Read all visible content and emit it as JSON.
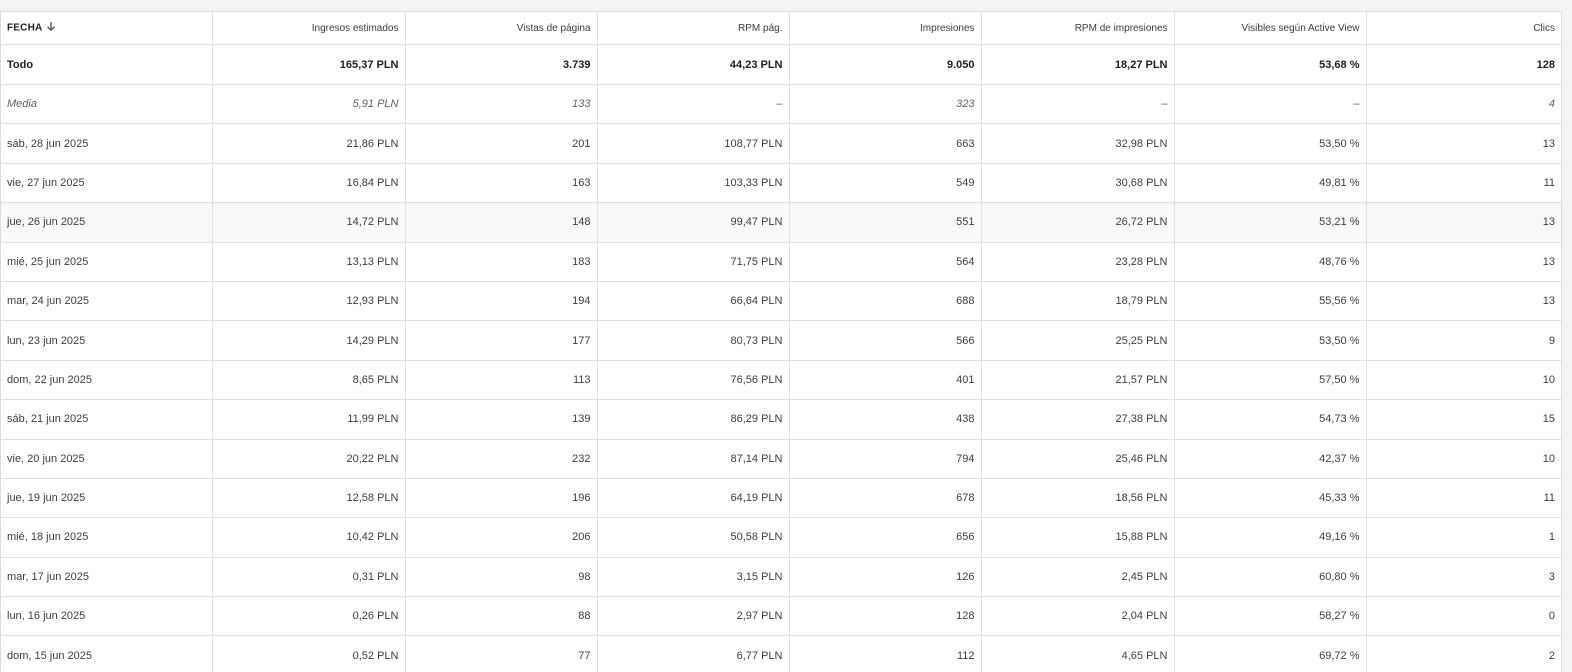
{
  "table": {
    "columns": [
      {
        "key": "date",
        "label": "FECHA"
      },
      {
        "key": "revenue",
        "label": "Ingresos estimados"
      },
      {
        "key": "pageviews",
        "label": "Vistas de página"
      },
      {
        "key": "page_rpm",
        "label": "RPM pág."
      },
      {
        "key": "impressions",
        "label": "Impresiones"
      },
      {
        "key": "impression_rpm",
        "label": "RPM de impresiones"
      },
      {
        "key": "active_view",
        "label": "Visibles según Active View"
      },
      {
        "key": "clicks",
        "label": "Clics"
      }
    ],
    "sort": {
      "column": "date",
      "direction": "descending",
      "icon": "arrow-down-icon"
    },
    "total": [
      "Todo",
      "165,37 PLN",
      "3.739",
      "44,23 PLN",
      "9.050",
      "18,27 PLN",
      "53,68 %",
      "128"
    ],
    "average": [
      "Media",
      "5,91 PLN",
      "133",
      "–",
      "323",
      "–",
      "–",
      "4"
    ],
    "rows": [
      [
        "sáb, 28 jun 2025",
        "21,86 PLN",
        "201",
        "108,77 PLN",
        "663",
        "32,98 PLN",
        "53,50 %",
        "13"
      ],
      [
        "vie, 27 jun 2025",
        "16,84 PLN",
        "163",
        "103,33 PLN",
        "549",
        "30,68 PLN",
        "49,81 %",
        "11"
      ],
      [
        "jue, 26 jun 2025",
        "14,72 PLN",
        "148",
        "99,47 PLN",
        "551",
        "26,72 PLN",
        "53,21 %",
        "13"
      ],
      [
        "mié, 25 jun 2025",
        "13,13 PLN",
        "183",
        "71,75 PLN",
        "564",
        "23,28 PLN",
        "48,76 %",
        "13"
      ],
      [
        "mar, 24 jun 2025",
        "12,93 PLN",
        "194",
        "66,64 PLN",
        "688",
        "18,79 PLN",
        "55,56 %",
        "13"
      ],
      [
        "lun, 23 jun 2025",
        "14,29 PLN",
        "177",
        "80,73 PLN",
        "566",
        "25,25 PLN",
        "53,50 %",
        "9"
      ],
      [
        "dom, 22 jun 2025",
        "8,65 PLN",
        "113",
        "76,56 PLN",
        "401",
        "21,57 PLN",
        "57,50 %",
        "10"
      ],
      [
        "sáb, 21 jun 2025",
        "11,99 PLN",
        "139",
        "86,29 PLN",
        "438",
        "27,38 PLN",
        "54,73 %",
        "15"
      ],
      [
        "vie, 20 jun 2025",
        "20,22 PLN",
        "232",
        "87,14 PLN",
        "794",
        "25,46 PLN",
        "42,37 %",
        "10"
      ],
      [
        "jue, 19 jun 2025",
        "12,58 PLN",
        "196",
        "64,19 PLN",
        "678",
        "18,56 PLN",
        "45,33 %",
        "11"
      ],
      [
        "mié, 18 jun 2025",
        "10,42 PLN",
        "206",
        "50,58 PLN",
        "656",
        "15,88 PLN",
        "49,16 %",
        "1"
      ],
      [
        "mar, 17 jun 2025",
        "0,31 PLN",
        "98",
        "3,15 PLN",
        "126",
        "2,45 PLN",
        "60,80 %",
        "3"
      ],
      [
        "lun, 16 jun 2025",
        "0,26 PLN",
        "88",
        "2,97 PLN",
        "128",
        "2,04 PLN",
        "58,27 %",
        "0"
      ],
      [
        "dom, 15 jun 2025",
        "0,52 PLN",
        "77",
        "6,77 PLN",
        "112",
        "4,65 PLN",
        "69,72 %",
        "2"
      ]
    ],
    "hover_row_index": 2
  }
}
